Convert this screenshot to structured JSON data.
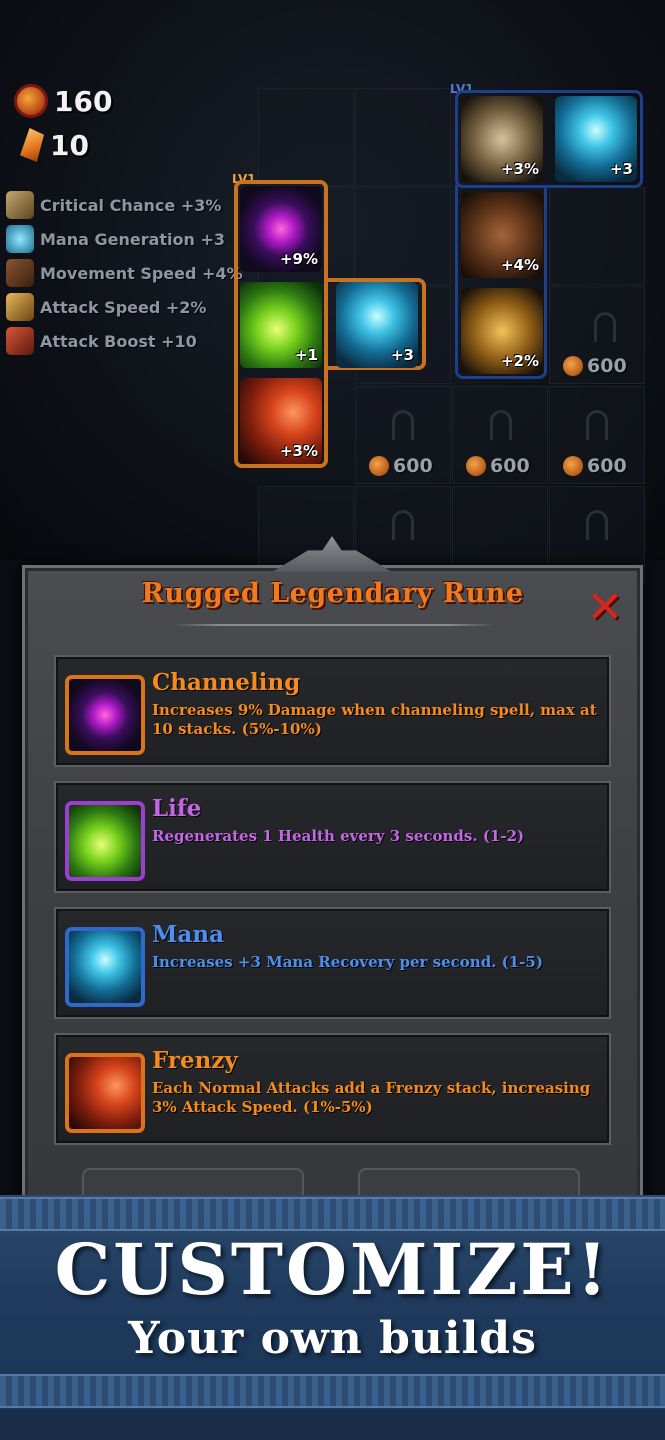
{
  "hud": {
    "coins": "160",
    "shards": "10"
  },
  "stats": [
    {
      "label": "Critical Chance +3%",
      "icon": "crossbow-icon"
    },
    {
      "label": "Mana Generation +3",
      "icon": "mana-icon"
    },
    {
      "label": "Movement Speed +4%",
      "icon": "boots-icon"
    },
    {
      "label": "Attack Speed +2%",
      "icon": "wing-icon"
    },
    {
      "label": "Attack Boost +10",
      "icon": "blade-icon"
    }
  ],
  "board": {
    "level_label_left": "LV1",
    "level_label_right": "LV1",
    "equipped": [
      {
        "name": "channeling",
        "value": "+9%"
      },
      {
        "name": "life",
        "value": "+1"
      },
      {
        "name": "mana",
        "value": "+3"
      },
      {
        "name": "frenzy",
        "value": "+3%"
      }
    ],
    "right_set": [
      {
        "name": "bow",
        "value": "+3%"
      },
      {
        "name": "mana",
        "value": "+3"
      },
      {
        "name": "boots",
        "value": "+4%"
      },
      {
        "name": "wing",
        "value": "+2%"
      }
    ],
    "prices": [
      "600",
      "600",
      "600",
      "600"
    ]
  },
  "dialog": {
    "title": "Rugged Legendary Rune",
    "close_symbol": "✕",
    "runes": [
      {
        "name": "Channeling",
        "description": "Increases 9% Damage when channeling spell, max at 10 stacks. (5%-10%)",
        "color": "#f58a1f",
        "border": "#d9741c"
      },
      {
        "name": "Life",
        "description": "Regenerates 1 Health every 3 seconds. (1-2)",
        "color": "#c466e6",
        "border": "#9a3fd0"
      },
      {
        "name": "Mana",
        "description": "Increases +3 Mana Recovery per second. (1-5)",
        "color": "#4d8fee",
        "border": "#2f69c9"
      },
      {
        "name": "Frenzy",
        "description": "Each Normal Attacks add a Frenzy stack, increasing 3% Attack Speed. (1%-5%)",
        "color": "#f58a1f",
        "border": "#d9741c"
      }
    ]
  },
  "banner": {
    "headline": "CUSTOMIZE!",
    "subline": "Your own builds"
  }
}
